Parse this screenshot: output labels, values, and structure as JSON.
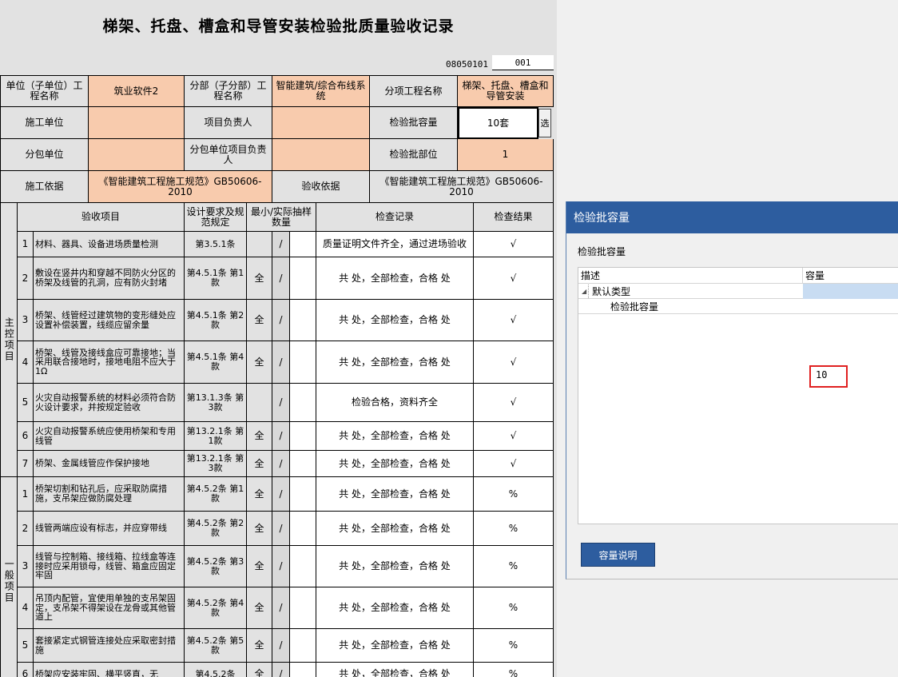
{
  "form": {
    "title": "梯架、托盘、槽盒和导管安装检验批质量验收记录",
    "code_prefix": "08050101",
    "code_suffix": "001"
  },
  "header": {
    "unit_label": "单位（子单位）工程名称",
    "unit_value": "筑业软件2",
    "division_label": "分部（子分部）工程名称",
    "division_value": "智能建筑/综合布线系统",
    "subitem_label": "分项工程名称",
    "subitem_value": "梯架、托盘、槽盒和导管安装",
    "contractor_label": "施工单位",
    "contractor_value": "",
    "pm_label": "项目负责人",
    "pm_value": "",
    "capacity_label": "检验批容量",
    "capacity_value": "10套",
    "select_label": "选",
    "subcontractor_label": "分包单位",
    "subcontractor_value": "",
    "sub_pm_label": "分包单位项目负责人",
    "sub_pm_value": "",
    "batch_part_label": "检验批部位",
    "batch_part_value": "1",
    "basis_label": "施工依据",
    "basis_value": "《智能建筑工程施工规范》GB50606-2010",
    "acceptance_basis_label": "验收依据",
    "acceptance_basis_value": "《智能建筑工程施工规范》GB50606-2010"
  },
  "columns": {
    "item": "验收项目",
    "requirement": "设计要求及规范规定",
    "sample": "最小/实际抽样数量",
    "record": "检查记录",
    "result": "检查结果"
  },
  "main_label": "主控项目",
  "general_label": "一般项目",
  "main_rows": [
    {
      "no": "1",
      "item": "材料、器具、设备进场质量检测",
      "req": "第3.5.1条",
      "min": "",
      "slash": "/",
      "record": "质量证明文件齐全，通过进场验收",
      "result": "√"
    },
    {
      "no": "2",
      "item": "敷设在竖井内和穿越不同防火分区的桥架及线管的孔洞，应有防火封堵",
      "req": "第4.5.1条 第1款",
      "min": "全",
      "slash": "/",
      "record": "共 处，全部检查，合格 处",
      "result": "√"
    },
    {
      "no": "3",
      "item": "桥架、线管经过建筑物的变形缝处应设置补偿装置，线缆应留余量",
      "req": "第4.5.1条 第2款",
      "min": "全",
      "slash": "/",
      "record": "共 处，全部检查，合格 处",
      "result": "√"
    },
    {
      "no": "4",
      "item": "桥架、线管及接线盒应可靠接地；当采用联合接地时，接地电阻不应大于1Ω",
      "req": "第4.5.1条 第4款",
      "min": "全",
      "slash": "/",
      "record": "共 处，全部检查，合格 处",
      "result": "√"
    },
    {
      "no": "5",
      "item": "火灾自动报警系统的材料必须符合防火设计要求，并按规定验收",
      "req": "第13.1.3条 第3款",
      "min": "",
      "slash": "/",
      "record": "检验合格，资料齐全",
      "result": "√"
    },
    {
      "no": "6",
      "item": "火灾自动报警系统应使用桥架和专用线管",
      "req": "第13.2.1条 第1款",
      "min": "全",
      "slash": "/",
      "record": "共 处，全部检查，合格 处",
      "result": "√"
    },
    {
      "no": "7",
      "item": "桥架、金属线管应作保护接地",
      "req": "第13.2.1条 第3款",
      "min": "全",
      "slash": "/",
      "record": "共 处，全部检查，合格 处",
      "result": "√"
    }
  ],
  "general_rows": [
    {
      "no": "1",
      "item": "桥架切割和钻孔后，应采取防腐措施，支吊架应做防腐处理",
      "req": "第4.5.2条 第1款",
      "min": "全",
      "slash": "/",
      "record": "共 处，全部检查，合格 处",
      "result": "%"
    },
    {
      "no": "2",
      "item": "线管两端应设有标志，并应穿带线",
      "req": "第4.5.2条 第2款",
      "min": "全",
      "slash": "/",
      "record": "共 处，全部检查，合格 处",
      "result": "%"
    },
    {
      "no": "3",
      "item": "线管与控制箱、接线箱、拉线盒等连接时应采用锁母，线管、箱盒应固定牢固",
      "req": "第4.5.2条 第3款",
      "min": "全",
      "slash": "/",
      "record": "共 处，全部检查，合格 处",
      "result": "%"
    },
    {
      "no": "4",
      "item": "吊顶内配管，宜使用单独的支吊架固定，支吊架不得架设在龙骨或其他管道上",
      "req": "第4.5.2条 第4款",
      "min": "全",
      "slash": "/",
      "record": "共 处，全部检查，合格 处",
      "result": "%"
    },
    {
      "no": "5",
      "item": "套接紧定式钢管连接处应采取密封措施",
      "req": "第4.5.2条 第5款",
      "min": "全",
      "slash": "/",
      "record": "共 处，全部检查，合格 处",
      "result": "%"
    },
    {
      "no": "6",
      "item": "桥架应安装牢固、横平竖直，无",
      "req": "第4.5.2条",
      "min": "全",
      "slash": "/",
      "record": "共 处，全部检查，合格 处",
      "result": "%"
    }
  ],
  "dialog": {
    "title": "检验批容量",
    "heading": "检验批容量",
    "col_desc": "描述",
    "col_capacity": "容量",
    "group_label": "默认类型",
    "item_label": "检验批容量",
    "capacity_value": "10",
    "explain_button": "容量说明"
  }
}
